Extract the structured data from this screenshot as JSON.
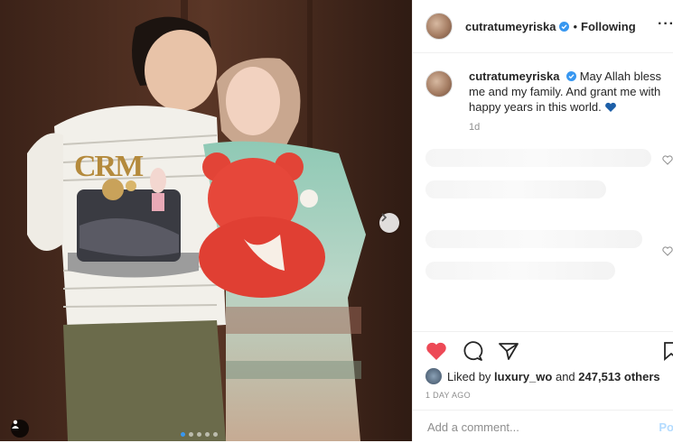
{
  "post": {
    "username": "cutratumeyriska",
    "separator": "•",
    "follow_status": "Following",
    "more_icon": "more-horizontal-icon",
    "caption_username": "cutratumeyriska",
    "caption_text": "May Allah bless me and my family. And grant me with happy years in this world.",
    "caption_emoji": "blue-heart-icon",
    "caption_time": "1d",
    "likes_prefix": "Liked by",
    "likes_user": "luxury_wo",
    "likes_joiner": "and",
    "likes_count": "247,513 others",
    "date": "1 DAY AGO",
    "comment_placeholder": "Add a comment...",
    "post_button": "Po"
  },
  "photo": {
    "cake_topper": "CRM",
    "carousel_dots": 5,
    "active_dot": 0
  },
  "colors": {
    "like_red": "#ed4956",
    "link_blue": "#3897f0",
    "muted": "#8e8e8e"
  }
}
